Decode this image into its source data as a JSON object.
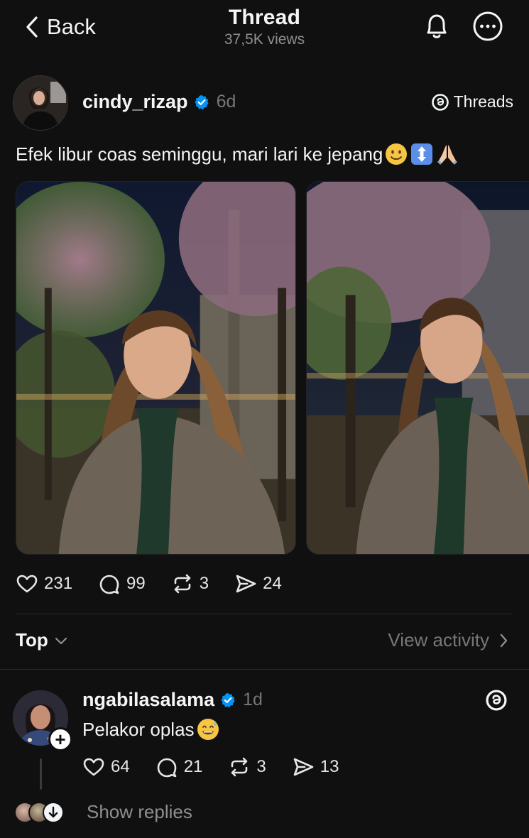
{
  "header": {
    "back_label": "Back",
    "title": "Thread",
    "views": "37,5K views"
  },
  "post": {
    "username": "cindy_rizap",
    "time": "6d",
    "threads_label": "Threads",
    "caption": "Efek libur coas seminggu, mari lari ke jepang",
    "caption_emojis": [
      "slightly-smiling-face",
      "up-down-arrow",
      "folded-hands"
    ],
    "stats": {
      "likes": "231",
      "comments": "99",
      "reposts": "3",
      "shares": "24"
    }
  },
  "sort": {
    "label": "Top",
    "view_activity": "View activity"
  },
  "reply": {
    "username": "ngabilasalama",
    "time": "1d",
    "text": "Pelakor oplas",
    "text_emoji": "grinning-sweat-face",
    "stats": {
      "likes": "64",
      "comments": "21",
      "reposts": "3",
      "shares": "13"
    },
    "show_replies": "Show replies"
  },
  "colors": {
    "background": "#101010",
    "text": "#f3f5f7",
    "muted": "#8f8f8f",
    "verified": "#0095f6"
  }
}
